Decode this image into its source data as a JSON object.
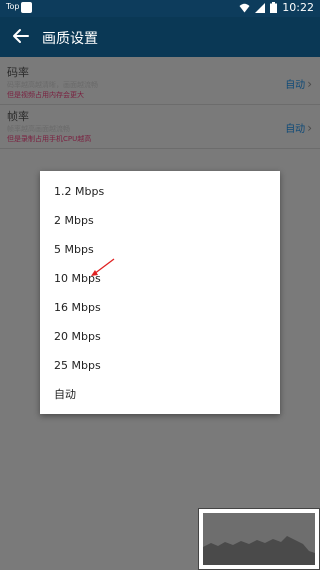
{
  "status_bar": {
    "carrier": "Top",
    "time": "10:22",
    "icons": [
      "app-icon",
      "wifi-icon",
      "signal-icon",
      "battery-icon"
    ]
  },
  "toolbar": {
    "back_icon": "arrow-left-icon",
    "title": "画质设置"
  },
  "settings": [
    {
      "name": "码率",
      "desc1": "码率越高越清晰，画面越流畅",
      "desc2": "但是视频占用内存会更大",
      "value": "自动"
    },
    {
      "name": "帧率",
      "desc1": "帧率越高画面越流畅",
      "desc2": "但是录制占用手机CPU越高",
      "value": "自动"
    }
  ],
  "dialog": {
    "options": [
      "1.2 Mbps",
      "2 Mbps",
      "5 Mbps",
      "10 Mbps",
      "16 Mbps",
      "20 Mbps",
      "25 Mbps",
      "自动"
    ]
  },
  "colors": {
    "status_bar": "#0d3c5c",
    "toolbar": "#0a3855",
    "dim_overlay": "#7a7a7a",
    "value_text": "#0f4a78",
    "warning_text": "#7a1f3f",
    "annotation_arrow": "#e02020"
  }
}
